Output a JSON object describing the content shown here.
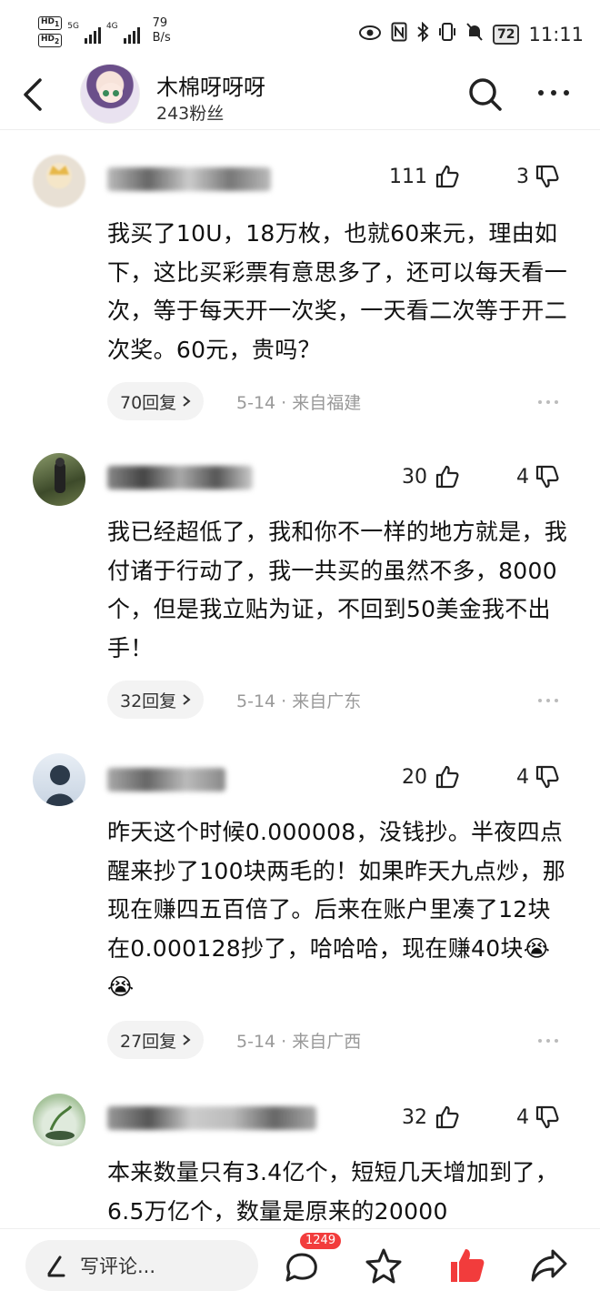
{
  "status_bar": {
    "hd1": "HD",
    "hd1_sub": "1",
    "hd2": "HD",
    "hd2_sub": "2",
    "net1": "5G",
    "net2": "4G",
    "speed_value": "79",
    "speed_unit": "B/s",
    "battery": "72",
    "time": "11:11"
  },
  "header": {
    "user_name": "木棉呀呀呀",
    "fans": "243粉丝",
    "icons": [
      "back-arrow-icon",
      "search-icon",
      "more-dots-icon"
    ]
  },
  "comments": [
    {
      "likes": "111",
      "dislikes": "3",
      "text": "我买了10U，18万枚，也就60来元，理由如下，这比买彩票有意思多了，还可以每天看一次，等于每天开一次奖，一天看二次等于开二次奖。60元，贵吗？",
      "replies": "70回复",
      "meta": "5-14 · 来自福建"
    },
    {
      "likes": "30",
      "dislikes": "4",
      "text": "我已经超低了，我和你不一样的地方就是，我付诸于行动了，我一共买的虽然不多，8000个，但是我立贴为证，不回到50美金我不出手！",
      "replies": "32回复",
      "meta": "5-14 · 来自广东"
    },
    {
      "likes": "20",
      "dislikes": "4",
      "text": "昨天这个时候0.000008，没钱抄。半夜四点醒来抄了100块两毛的！如果昨天九点炒，那现在赚四五百倍了。后来在账户里凑了12块在0.000128抄了，哈哈哈，现在赚40块",
      "emoji": "😭😭",
      "replies": "27回复",
      "meta": "5-14 · 来自广西"
    },
    {
      "likes": "32",
      "dislikes": "4",
      "text": "本来数量只有3.4亿个，短短几天增加到了，6.5万亿个，数量是原来的20000"
    }
  ],
  "bottom_bar": {
    "input_placeholder": "写评论...",
    "comment_count": "1249",
    "accent": "#f23c3c"
  }
}
